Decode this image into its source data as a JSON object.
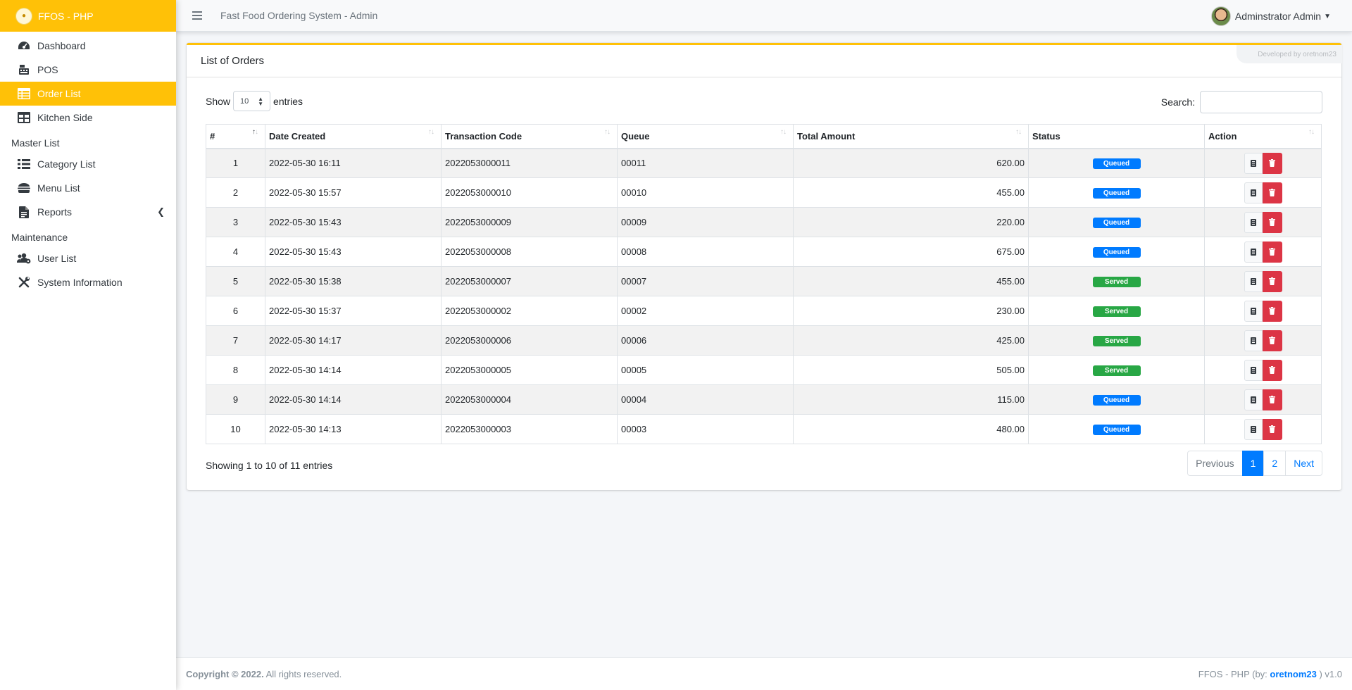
{
  "brand": {
    "name": "FFOS - PHP"
  },
  "topbar": {
    "title": "Fast Food Ordering System - Admin",
    "user_name": "Adminstrator Admin"
  },
  "sidebar": {
    "items": [
      {
        "label": "Dashboard",
        "icon": "tachometer-icon",
        "active": false
      },
      {
        "label": "POS",
        "icon": "cash-register-icon",
        "active": false
      },
      {
        "label": "Order List",
        "icon": "table-icon",
        "active": true
      },
      {
        "label": "Kitchen Side",
        "icon": "grid-icon",
        "active": false
      }
    ],
    "master_header": "Master List",
    "master_items": [
      {
        "label": "Category List",
        "icon": "list-icon"
      },
      {
        "label": "Menu List",
        "icon": "burger-icon"
      },
      {
        "label": "Reports",
        "icon": "file-icon"
      }
    ],
    "maintenance_header": "Maintenance",
    "maintenance_items": [
      {
        "label": "User List",
        "icon": "users-cog-icon"
      },
      {
        "label": "System Information",
        "icon": "tools-icon"
      }
    ]
  },
  "card": {
    "title": "List of Orders",
    "dev_badge": "Developed by oretnom23",
    "show_label": "Show",
    "entries_value": "10",
    "entries_label": "entries",
    "search_label": "Search:",
    "search_value": "",
    "columns": [
      "#",
      "Date Created",
      "Transaction Code",
      "Queue",
      "Total Amount",
      "Status",
      "Action"
    ],
    "rows": [
      {
        "n": "1",
        "date": "2022-05-30 16:11",
        "code": "2022053000011",
        "queue": "00011",
        "amount": "620.00",
        "status": "Queued"
      },
      {
        "n": "2",
        "date": "2022-05-30 15:57",
        "code": "2022053000010",
        "queue": "00010",
        "amount": "455.00",
        "status": "Queued"
      },
      {
        "n": "3",
        "date": "2022-05-30 15:43",
        "code": "2022053000009",
        "queue": "00009",
        "amount": "220.00",
        "status": "Queued"
      },
      {
        "n": "4",
        "date": "2022-05-30 15:43",
        "code": "2022053000008",
        "queue": "00008",
        "amount": "675.00",
        "status": "Queued"
      },
      {
        "n": "5",
        "date": "2022-05-30 15:38",
        "code": "2022053000007",
        "queue": "00007",
        "amount": "455.00",
        "status": "Served"
      },
      {
        "n": "6",
        "date": "2022-05-30 15:37",
        "code": "2022053000002",
        "queue": "00002",
        "amount": "230.00",
        "status": "Served"
      },
      {
        "n": "7",
        "date": "2022-05-30 14:17",
        "code": "2022053000006",
        "queue": "00006",
        "amount": "425.00",
        "status": "Served"
      },
      {
        "n": "8",
        "date": "2022-05-30 14:14",
        "code": "2022053000005",
        "queue": "00005",
        "amount": "505.00",
        "status": "Served"
      },
      {
        "n": "9",
        "date": "2022-05-30 14:14",
        "code": "2022053000004",
        "queue": "00004",
        "amount": "115.00",
        "status": "Queued"
      },
      {
        "n": "10",
        "date": "2022-05-30 14:13",
        "code": "2022053000003",
        "queue": "00003",
        "amount": "480.00",
        "status": "Queued"
      }
    ],
    "info": "Showing 1 to 10 of 11 entries",
    "pagination": {
      "previous": "Previous",
      "pages": [
        "1",
        "2"
      ],
      "active": "1",
      "next": "Next"
    }
  },
  "footer": {
    "copyright_bold": "Copyright © 2022.",
    "copyright_rest": " All rights reserved.",
    "right_prefix": "FFOS - PHP (by: ",
    "author": "oretnom23",
    "right_suffix": " ) v1.0"
  },
  "colors": {
    "accent": "#ffc107",
    "queued": "#007bff",
    "served": "#28a745",
    "delete": "#dc3545"
  }
}
